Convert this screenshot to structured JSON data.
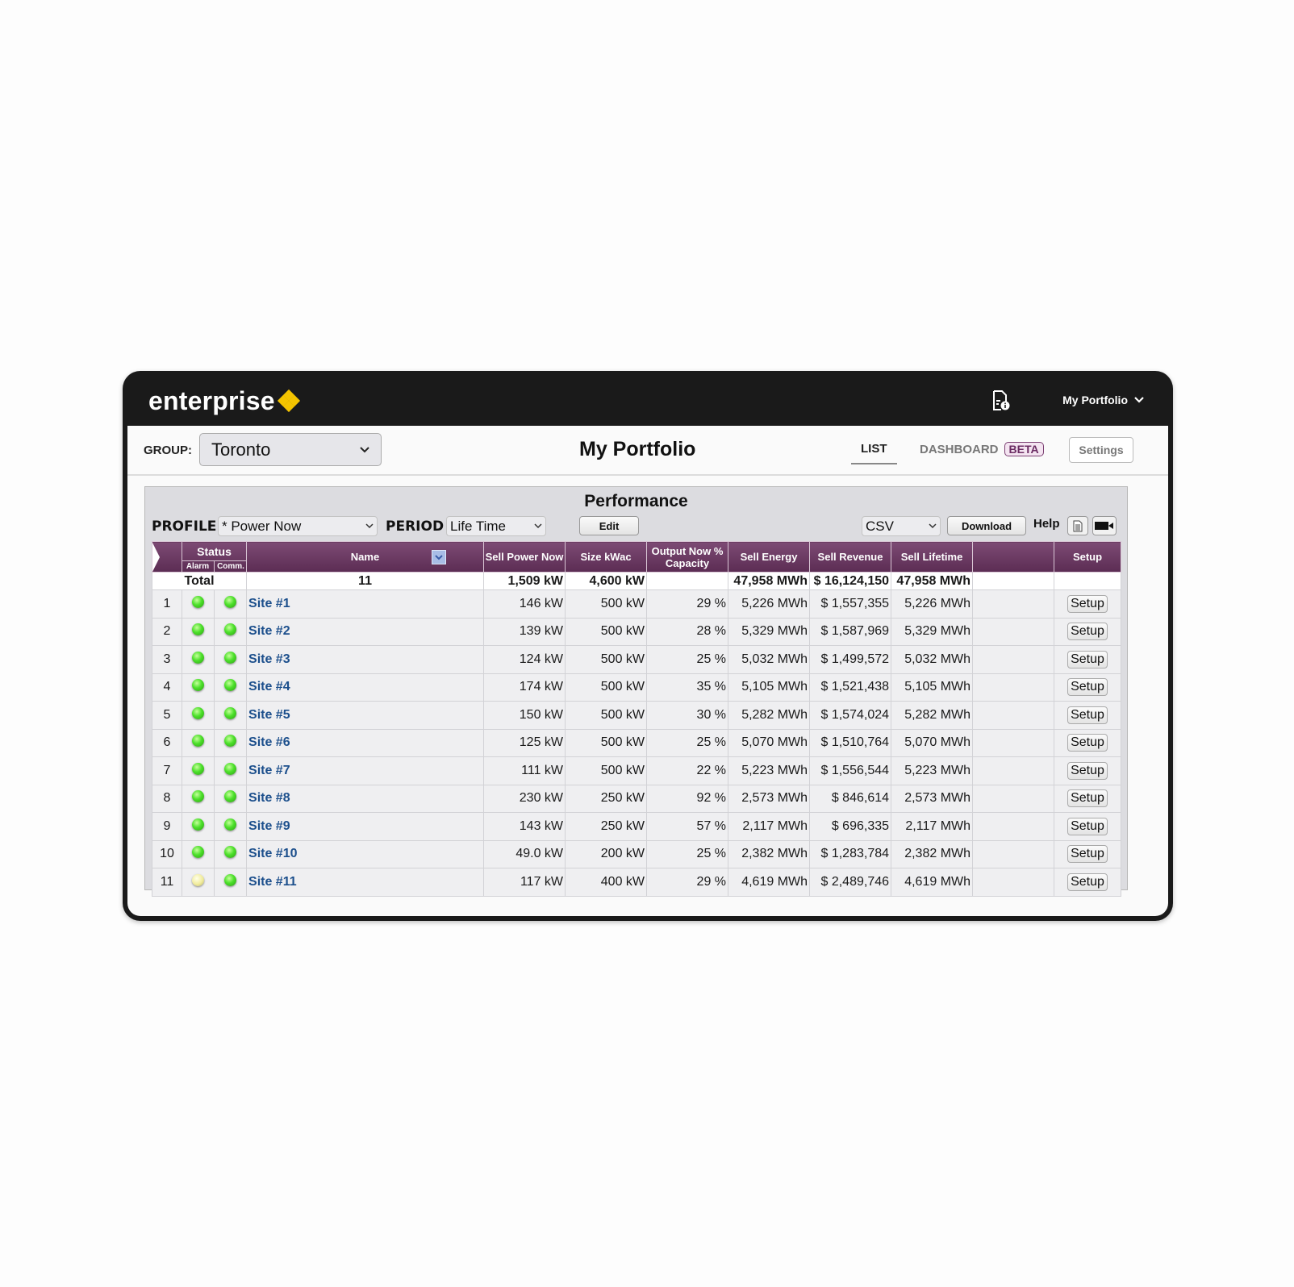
{
  "topbar": {
    "logo": "enterprise",
    "doc_icon": "document-info-icon",
    "portfolio_menu": "My Portfolio"
  },
  "header": {
    "group_label": "GROUP:",
    "group_value": "Toronto",
    "title": "My Portfolio",
    "tabs": [
      {
        "label": "LIST",
        "active": true
      },
      {
        "label": "DASHBOARD",
        "badge": "BETA",
        "active": false
      }
    ],
    "settings_label": "Settings"
  },
  "performance": {
    "title": "Performance",
    "profile_label": "PROFILE",
    "profile_value": "* Power Now",
    "period_label": "PERIOD",
    "period_value": "Life Time",
    "edit_label": "Edit",
    "export_format": "CSV",
    "download_label": "Download",
    "help_label": "Help",
    "columns": {
      "status": "Status",
      "alarm": "Alarm",
      "comm": "Comm.",
      "name": "Name",
      "sell_power_now": "Sell Power Now",
      "size_kwac": "Size kWac",
      "output_now_capacity": "Output Now % Capacity",
      "sell_energy": "Sell Energy",
      "sell_revenue": "Sell Revenue",
      "sell_lifetime": "Sell Lifetime",
      "blank": "",
      "setup": "Setup"
    },
    "total": {
      "label": "Total",
      "count": "11",
      "sell_power_now": "1,509 kW",
      "size_kwac": "4,600 kW",
      "output_now_capacity": "",
      "sell_energy": "47,958 MWh",
      "sell_revenue": "$ 16,124,150",
      "sell_lifetime": "47,958 MWh"
    },
    "rows": [
      {
        "idx": "1",
        "alarm": "green",
        "comm": "green",
        "name": "Site #1",
        "power": "146 kW",
        "size": "500 kW",
        "capacity": "29 %",
        "energy": "5,226 MWh",
        "revenue": "$ 1,557,355",
        "lifetime": "5,226 MWh",
        "setup": "Setup"
      },
      {
        "idx": "2",
        "alarm": "green",
        "comm": "green",
        "name": "Site #2",
        "power": "139 kW",
        "size": "500 kW",
        "capacity": "28 %",
        "energy": "5,329 MWh",
        "revenue": "$ 1,587,969",
        "lifetime": "5,329 MWh",
        "setup": "Setup"
      },
      {
        "idx": "3",
        "alarm": "green",
        "comm": "green",
        "name": "Site #3",
        "power": "124 kW",
        "size": "500 kW",
        "capacity": "25 %",
        "energy": "5,032 MWh",
        "revenue": "$ 1,499,572",
        "lifetime": "5,032 MWh",
        "setup": "Setup"
      },
      {
        "idx": "4",
        "alarm": "green",
        "comm": "green",
        "name": "Site #4",
        "power": "174 kW",
        "size": "500 kW",
        "capacity": "35 %",
        "energy": "5,105 MWh",
        "revenue": "$ 1,521,438",
        "lifetime": "5,105 MWh",
        "setup": "Setup"
      },
      {
        "idx": "5",
        "alarm": "green",
        "comm": "green",
        "name": "Site #5",
        "power": "150 kW",
        "size": "500 kW",
        "capacity": "30 %",
        "energy": "5,282 MWh",
        "revenue": "$ 1,574,024",
        "lifetime": "5,282 MWh",
        "setup": "Setup"
      },
      {
        "idx": "6",
        "alarm": "green",
        "comm": "green",
        "name": "Site #6",
        "power": "125 kW",
        "size": "500 kW",
        "capacity": "25 %",
        "energy": "5,070 MWh",
        "revenue": "$ 1,510,764",
        "lifetime": "5,070 MWh",
        "setup": "Setup"
      },
      {
        "idx": "7",
        "alarm": "green",
        "comm": "green",
        "name": "Site #7",
        "power": "111 kW",
        "size": "500 kW",
        "capacity": "22 %",
        "energy": "5,223 MWh",
        "revenue": "$ 1,556,544",
        "lifetime": "5,223 MWh",
        "setup": "Setup"
      },
      {
        "idx": "8",
        "alarm": "green",
        "comm": "green",
        "name": "Site #8",
        "power": "230 kW",
        "size": "250 kW",
        "capacity": "92 %",
        "energy": "2,573 MWh",
        "revenue": "$ 846,614",
        "lifetime": "2,573 MWh",
        "setup": "Setup"
      },
      {
        "idx": "9",
        "alarm": "green",
        "comm": "green",
        "name": "Site #9",
        "power": "143 kW",
        "size": "250 kW",
        "capacity": "57 %",
        "energy": "2,117 MWh",
        "revenue": "$ 696,335",
        "lifetime": "2,117 MWh",
        "setup": "Setup"
      },
      {
        "idx": "10",
        "alarm": "green",
        "comm": "green",
        "name": "Site #10",
        "power": "49.0 kW",
        "size": "200 kW",
        "capacity": "25 %",
        "energy": "2,382 MWh",
        "revenue": "$ 1,283,784",
        "lifetime": "2,382 MWh",
        "setup": "Setup"
      },
      {
        "idx": "11",
        "alarm": "yellow",
        "comm": "green",
        "name": "Site #11",
        "power": "117 kW",
        "size": "400 kW",
        "capacity": "29 %",
        "energy": "4,619 MWh",
        "revenue": "$ 2,489,746",
        "lifetime": "4,619 MWh",
        "setup": "Setup"
      }
    ]
  },
  "colors": {
    "header_purple": "#6b3a63",
    "link_blue": "#1c4f8c",
    "status_ok": "#4ce02a",
    "status_warning": "#f1ec9c",
    "logo_accent": "#f4c400"
  }
}
